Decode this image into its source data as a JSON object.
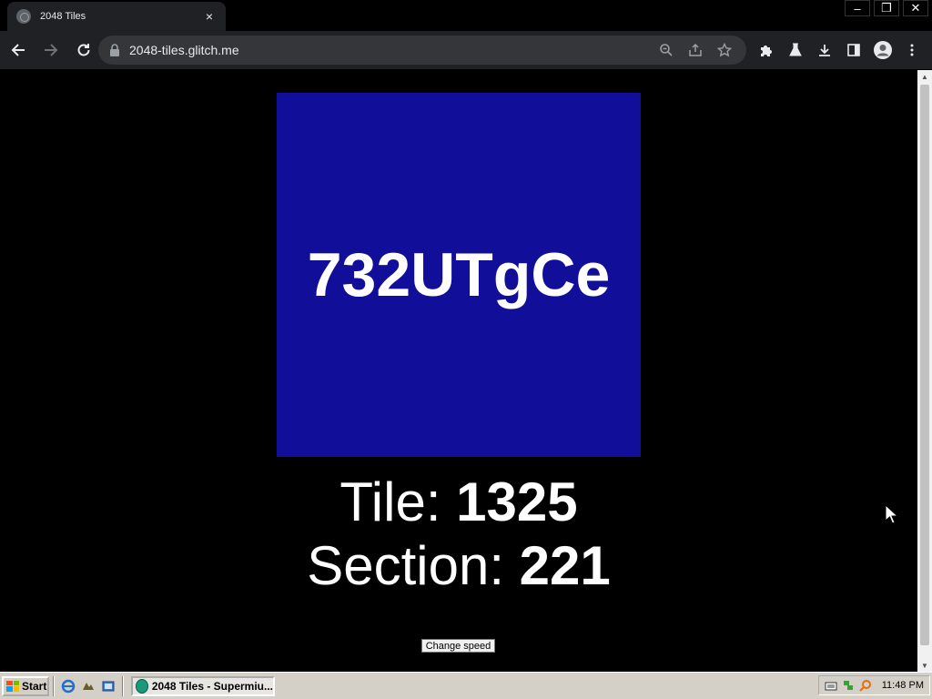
{
  "browser": {
    "tab_title": "2048 Tiles",
    "tab_close": "×",
    "url": "2048-tiles.glitch.me",
    "window_controls": {
      "minimize": "–",
      "restore": "❐",
      "close": "✕"
    }
  },
  "page": {
    "tile_code": "732UTgCe",
    "tile_color": "#110e99",
    "tile_label": "Tile: ",
    "tile_number": "1325",
    "section_label": "Section: ",
    "section_number": "221",
    "speed_button": "Change speed"
  },
  "taskbar": {
    "start_label": "Start",
    "task_button": "2048 Tiles - Supermiu...",
    "clock": "11:48 PM"
  }
}
